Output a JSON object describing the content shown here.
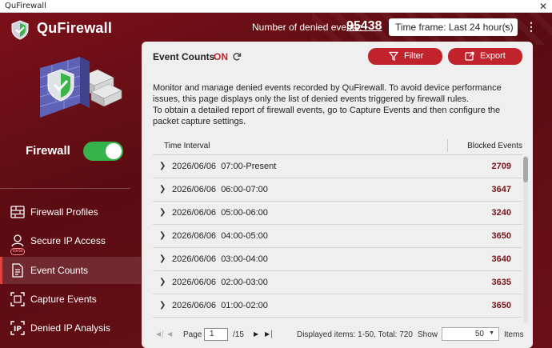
{
  "window": {
    "title": "QuFirewall",
    "close_glyph": "✕"
  },
  "header": {
    "app_name": "QuFirewall",
    "denied_label": "Number of denied events:",
    "denied_count": "95438",
    "timeframe": "Time frame: Last 24 hour(s)",
    "kebab": "⋮"
  },
  "sidebar": {
    "firewall_label": "Firewall",
    "firewall_enabled": true,
    "items": [
      {
        "label": "Firewall Profiles",
        "icon": "firewall-profiles-icon",
        "active": false
      },
      {
        "label": "Secure IP Access",
        "icon": "secure-ip-access-icon",
        "badge": "Beta",
        "active": false
      },
      {
        "label": "Event Counts",
        "icon": "event-counts-icon",
        "active": true
      },
      {
        "label": "Capture Events",
        "icon": "capture-events-icon",
        "active": false
      },
      {
        "label": "Denied IP Analysis",
        "icon": "denied-ip-analysis-icon",
        "active": false
      }
    ]
  },
  "main": {
    "title": "Event Counts",
    "status": "ON",
    "filter_label": "Filter",
    "export_label": "Export",
    "description": [
      "Monitor and manage denied events recorded by QuFirewall. To avoid device performance issues, this page displays only the list of denied events triggered by firewall rules.",
      "To obtain a detailed report of firewall events, go to Capture Events and then configure the packet capture settings."
    ],
    "columns": {
      "time": "Time Interval",
      "blocked": "Blocked Events"
    },
    "rows": [
      {
        "date": "2026/06/06",
        "interval": "07:00-Present",
        "blocked": "2709"
      },
      {
        "date": "2026/06/06",
        "interval": "06:00-07:00",
        "blocked": "3647"
      },
      {
        "date": "2026/06/06",
        "interval": "05:00-06:00",
        "blocked": "3240"
      },
      {
        "date": "2026/06/06",
        "interval": "04:00-05:00",
        "blocked": "3650"
      },
      {
        "date": "2026/06/06",
        "interval": "03:00-04:00",
        "blocked": "3640"
      },
      {
        "date": "2026/06/06",
        "interval": "02:00-03:00",
        "blocked": "3635"
      },
      {
        "date": "2026/06/06",
        "interval": "01:00-02:00",
        "blocked": "3650"
      }
    ],
    "pagination": {
      "page_label": "Page",
      "page_value": "1",
      "page_total": "/15",
      "items_info": "Displayed items: 1-50, Total: 720",
      "show_label": "Show",
      "show_value": "50",
      "items_label": "Items"
    }
  },
  "colors": {
    "accent": "#c0232c",
    "toggle_on": "#35b34a",
    "value_text": "#7a1219"
  }
}
